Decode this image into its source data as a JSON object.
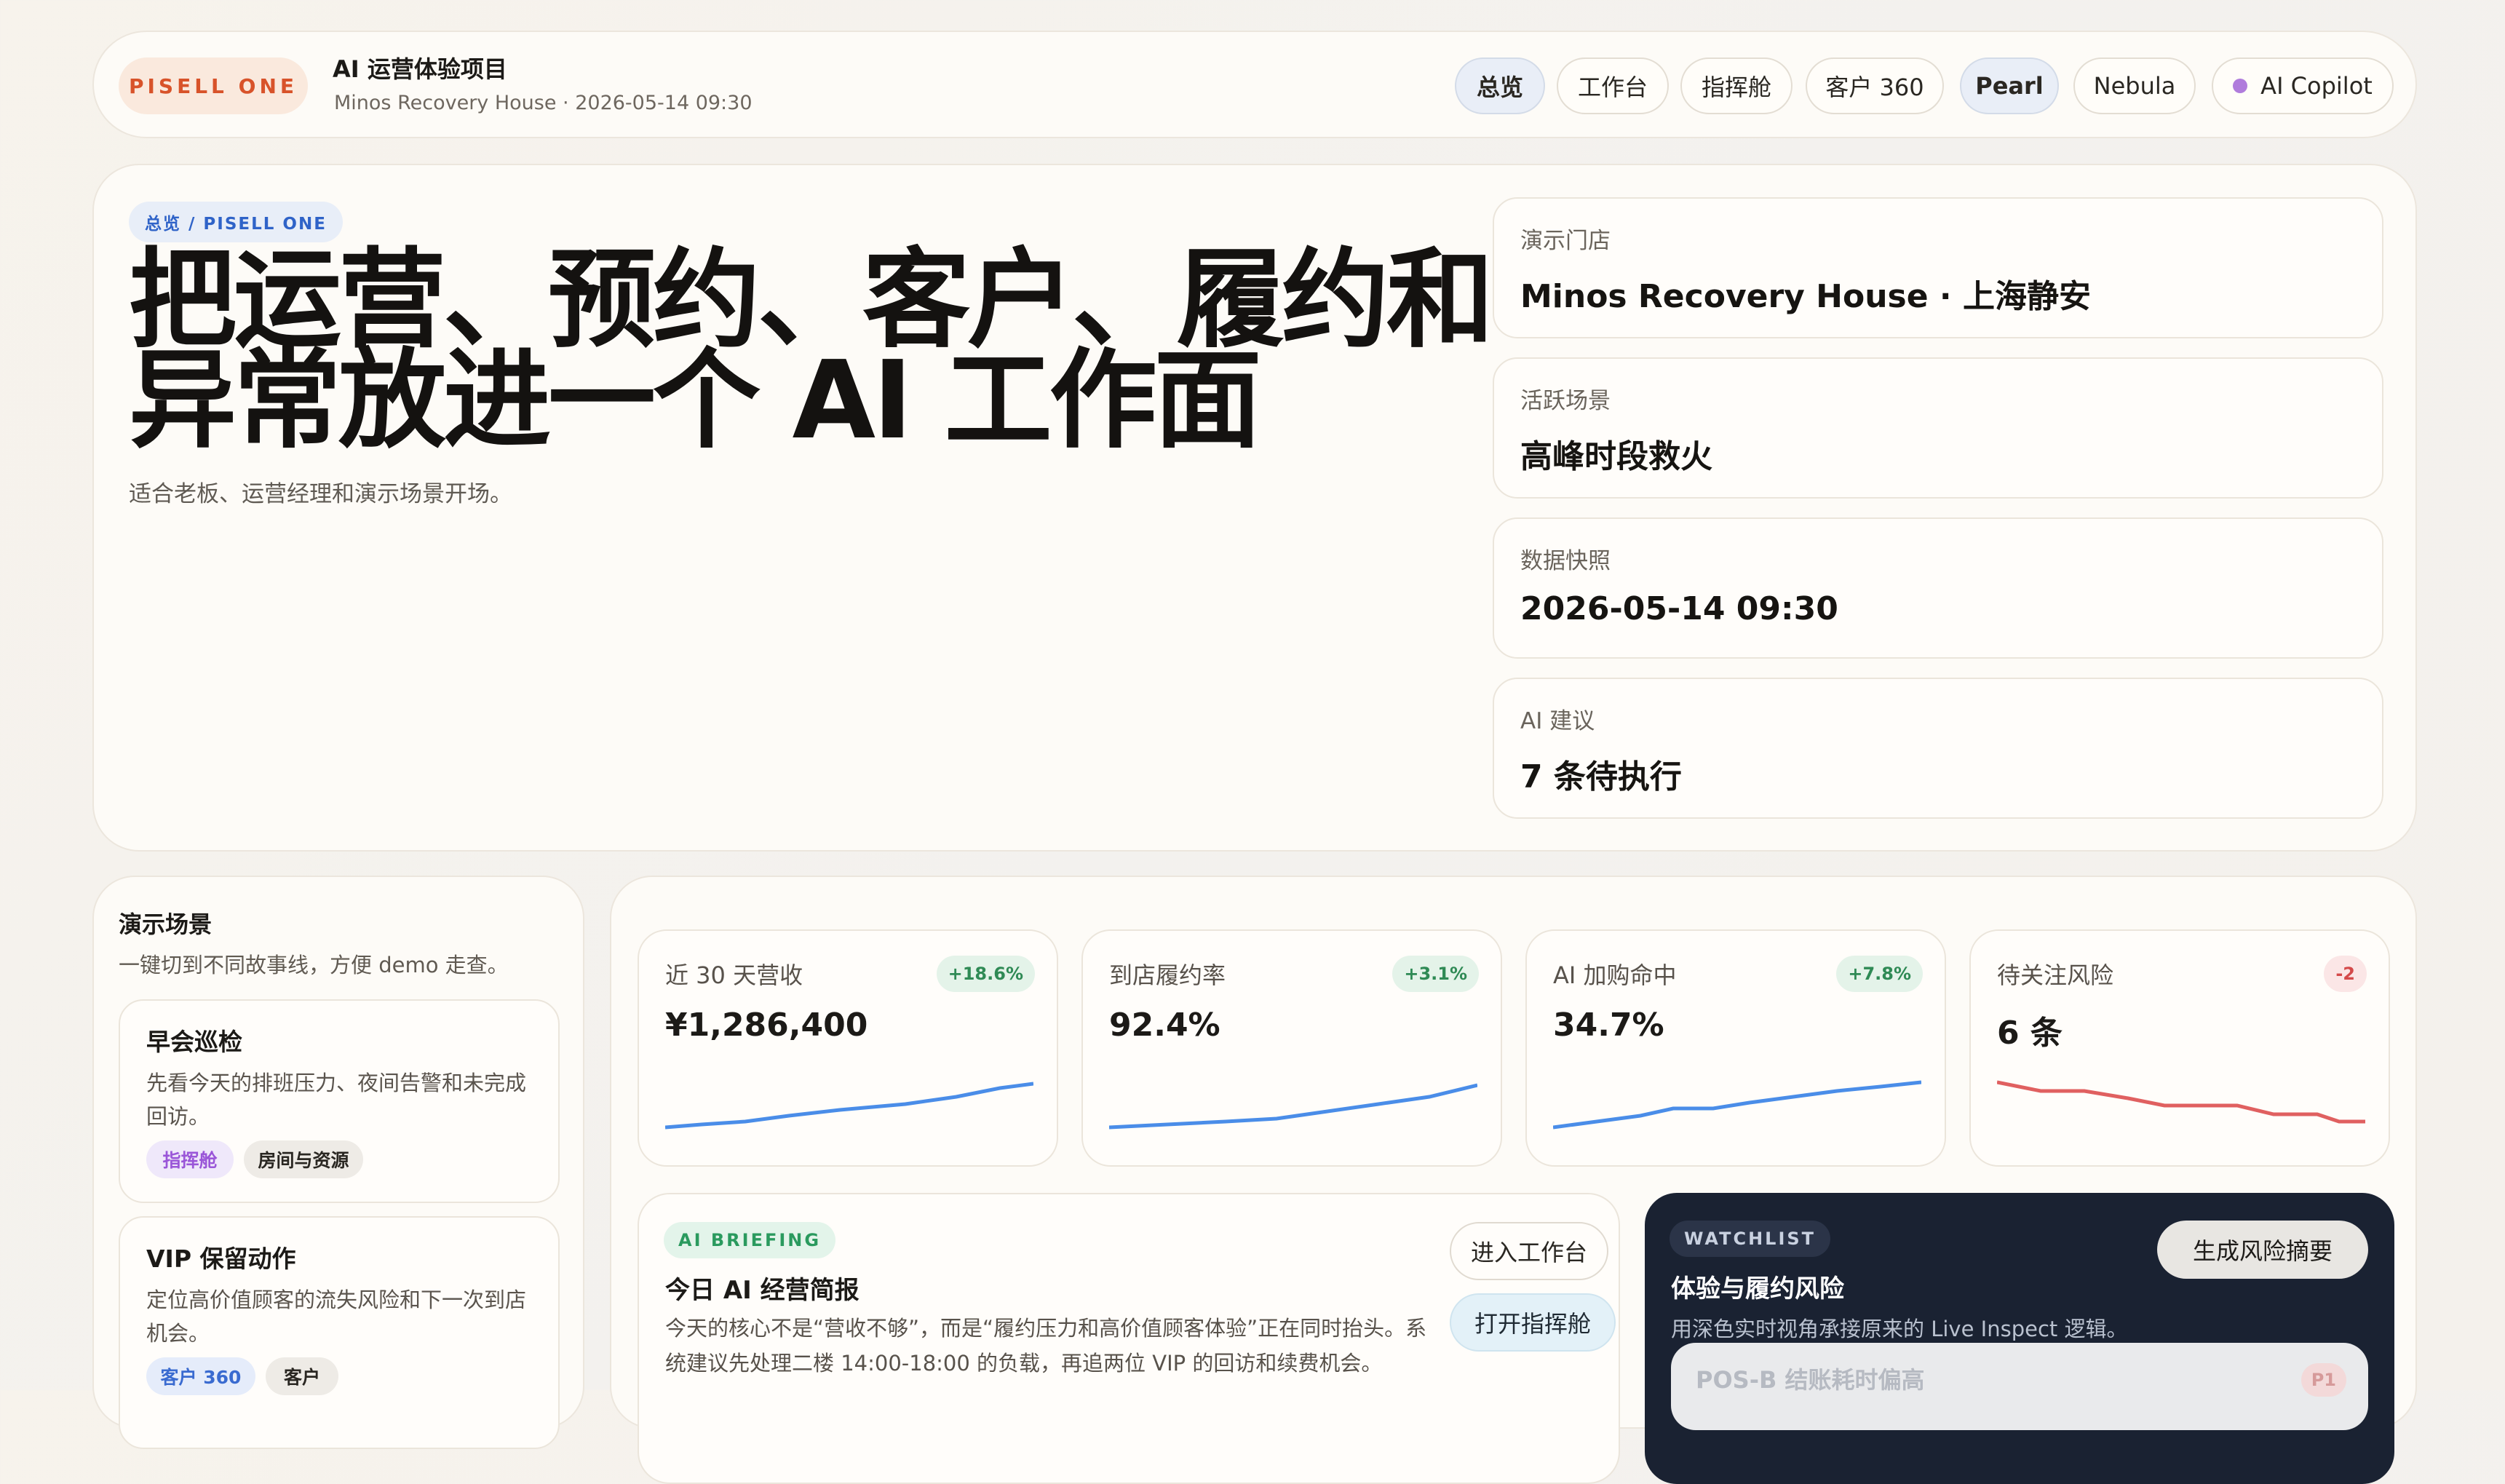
{
  "header": {
    "logo": "PISELL ONE",
    "project_title": "AI 运营体验项目",
    "project_subtitle": "Minos Recovery House · 2026-05-14 09:30",
    "nav": [
      {
        "label": "总览",
        "active": true
      },
      {
        "label": "工作台",
        "active": false
      },
      {
        "label": "指挥舱",
        "active": false
      },
      {
        "label": "客户 360",
        "active": false
      },
      {
        "label": "Pearl",
        "active": true
      },
      {
        "label": "Nebula",
        "active": false
      }
    ],
    "copilot_label": "AI Copilot"
  },
  "hero": {
    "breadcrumb": "总览 / PISELL ONE",
    "title": "把运营、预约、客户、履约和异常放进一个 AI 工作面",
    "subtitle": "适合老板、运营经理和演示场景开场。",
    "info_cards": [
      {
        "label": "演示门店",
        "value": "Minos Recovery House · 上海静安"
      },
      {
        "label": "活跃场景",
        "value": "高峰时段救火"
      },
      {
        "label": "数据快照",
        "value": "2026-05-14 09:30"
      },
      {
        "label": "AI 建议",
        "value": "7 条待执行"
      }
    ]
  },
  "scenarios": {
    "title": "演示场景",
    "subtitle": "一键切到不同故事线，方便 demo 走查。",
    "items": [
      {
        "title": "早会巡检",
        "desc": "先看今天的排班压力、夜间告警和未完成回访。",
        "tags": [
          "指挥舱",
          "房间与资源"
        ]
      },
      {
        "title": "VIP 保留动作",
        "desc": "定位高价值顾客的流失风险和下一次到店机会。",
        "tags": [
          "客户 360",
          "客户"
        ]
      }
    ]
  },
  "kpis": [
    {
      "label": "近 30 天营收",
      "value": "¥1,286,400",
      "delta": "+18.6%",
      "trend": "up"
    },
    {
      "label": "到店履约率",
      "value": "92.4%",
      "delta": "+3.1%",
      "trend": "up"
    },
    {
      "label": "AI 加购命中",
      "value": "34.7%",
      "delta": "+7.8%",
      "trend": "up"
    },
    {
      "label": "待关注风险",
      "value": "6 条",
      "delta": "-2",
      "trend": "down"
    }
  ],
  "briefing": {
    "tag": "AI BRIEFING",
    "title": "今日 AI 经营简报",
    "body": "今天的核心不是“营收不够”，而是“履约压力和高价值顾客体验”正在同时抬头。系统建议先处理二楼 14:00-18:00 的负载，再追两位 VIP 的回访和续费机会。",
    "btn_workbench": "进入工作台",
    "btn_command": "打开指挥舱"
  },
  "watchlist": {
    "tag": "WATCHLIST",
    "title": "体验与履约风险",
    "subtitle": "用深色实时视角承接原来的 Live Inspect 逻辑。",
    "button": "生成风险摘要",
    "first_item": {
      "name": "POS-B 结账耗时偏高",
      "priority": "P1"
    }
  },
  "colors": {
    "accent_orange": "#d8532a",
    "accent_blue": "#4a8de8",
    "accent_red": "#e06060",
    "dark_panel": "#1a2232"
  }
}
